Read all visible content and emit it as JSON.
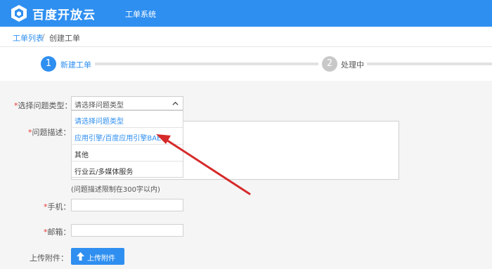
{
  "header": {
    "logo_text": "百度开放云",
    "system_title": "工单系统"
  },
  "breadcrumb": {
    "parent": "工单列表",
    "separator": "/",
    "current": "创建工单"
  },
  "steps": [
    {
      "number": "1",
      "label": "新建工单"
    },
    {
      "number": "2",
      "label": "处理中"
    }
  ],
  "form": {
    "required_mark": "*",
    "type_label": "选择问题类型：",
    "type_selected": "请选择问题类型",
    "type_options": [
      "请选择问题类型",
      "应用引擎/百度应用引擎BAE",
      "其他",
      "行业云/多媒体服务"
    ],
    "desc_label": "问题描述：",
    "desc_hint": "(问题描述限制在300字以内)",
    "phone_label": "手机：",
    "email_label": "邮箱：",
    "attach_label": "上传附件：",
    "upload_button": "上传附件"
  },
  "colors": {
    "brand": "#2f8ff0",
    "annotation_arrow": "#d62a2a"
  }
}
